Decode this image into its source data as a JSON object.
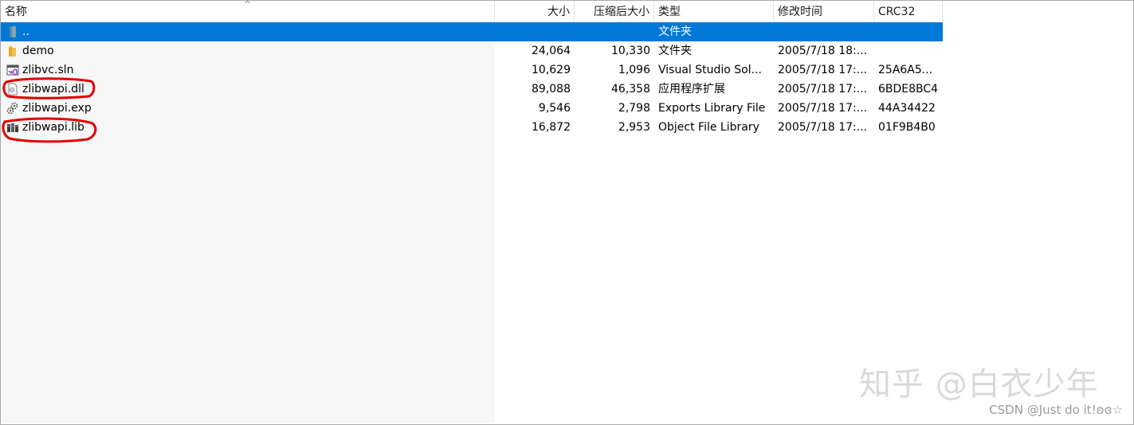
{
  "columns": {
    "name": "名称",
    "size": "大小",
    "packed": "压缩后大小",
    "type": "类型",
    "modified": "修改时间",
    "crc": "CRC32"
  },
  "sort_indicator": "^",
  "rows": [
    {
      "name": "..",
      "size": "",
      "packed": "",
      "type": "文件夹",
      "modified": "",
      "crc": "",
      "icon": "parent-folder-icon",
      "selected": true
    },
    {
      "name": "demo",
      "size": "24,064",
      "packed": "10,330",
      "type": "文件夹",
      "modified": "2005/7/18 18:...",
      "crc": "",
      "icon": "folder-icon"
    },
    {
      "name": "zlibvc.sln",
      "size": "10,629",
      "packed": "1,096",
      "type": "Visual Studio Sol...",
      "modified": "2005/7/18 17:...",
      "crc": "25A6A5...",
      "icon": "visual-studio-solution-icon"
    },
    {
      "name": "zlibwapi.dll",
      "size": "89,088",
      "packed": "46,358",
      "type": "应用程序扩展",
      "modified": "2005/7/18 17:...",
      "crc": "6BDE8BC4",
      "icon": "dll-file-icon"
    },
    {
      "name": "zlibwapi.exp",
      "size": "9,546",
      "packed": "2,798",
      "type": "Exports Library File",
      "modified": "2005/7/18 17:...",
      "crc": "44A34422",
      "icon": "exp-file-icon"
    },
    {
      "name": "zlibwapi.lib",
      "size": "16,872",
      "packed": "2,953",
      "type": "Object File Library",
      "modified": "2005/7/18 17:...",
      "crc": "01F9B4B0",
      "icon": "lib-file-icon"
    }
  ],
  "watermark": "知乎 @白衣少年",
  "credit": "CSDN @Just do it!ʚɞ☆",
  "colors": {
    "selection": "#0078d7",
    "annotation": "#e00000",
    "left_pane": "#f7f7f7"
  }
}
